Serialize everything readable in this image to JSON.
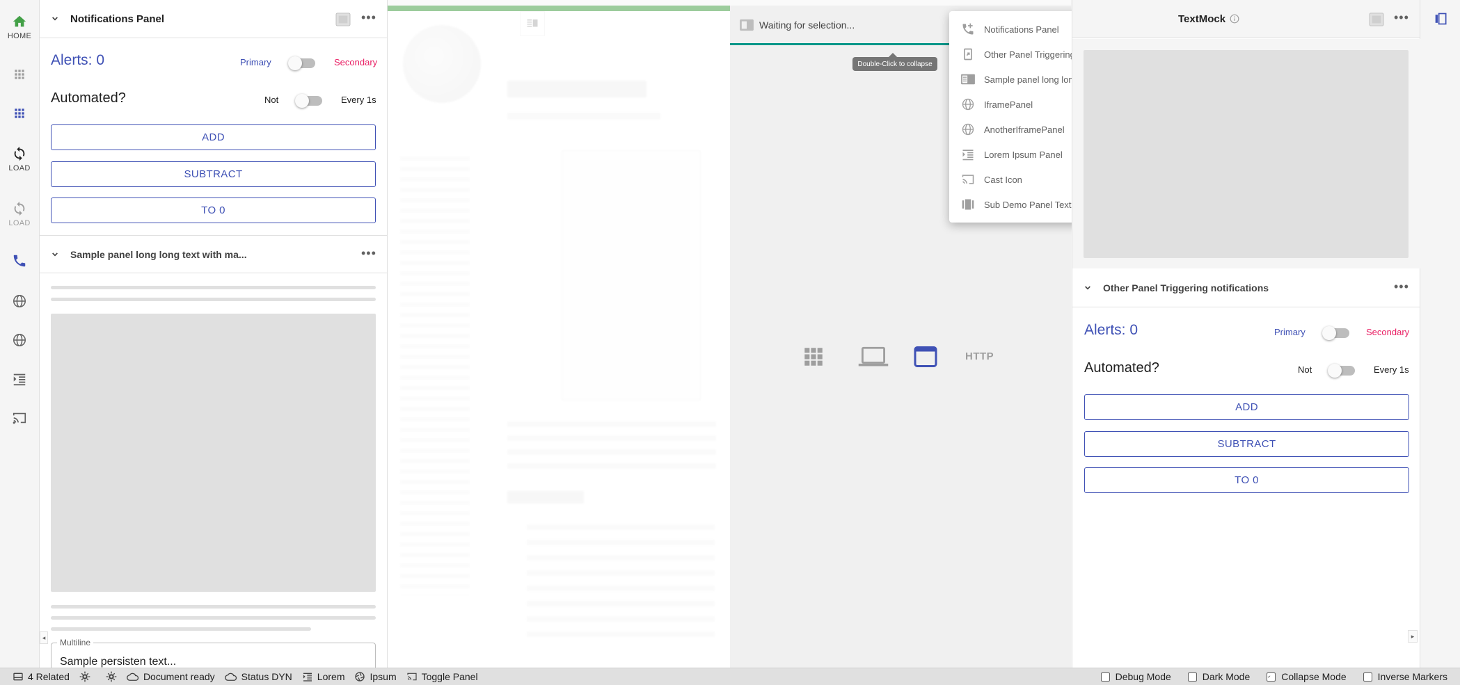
{
  "nav": {
    "home_label": "HOME",
    "load_label": "LOAD",
    "load2_label": "LOAD"
  },
  "left_panel": {
    "title": "Notifications Panel",
    "alerts": "Alerts: 0",
    "primary": "Primary",
    "secondary": "Secondary",
    "automated": "Automated?",
    "not_label": "Not",
    "every_label": "Every 1s",
    "add": "ADD",
    "subtract": "SUBTRACT",
    "to0": "TO 0"
  },
  "sample_panel": {
    "title": "Sample panel long long text with ma...",
    "multiline_label": "Multiline",
    "multiline_value": "Sample persisten text..."
  },
  "center": {
    "waiting": "Waiting for selection...",
    "tooltip": "Double-Click to collapse",
    "http_label": "HTTP"
  },
  "dropdown": {
    "items": [
      {
        "label": "Notifications Panel",
        "icon": "add-call-icon"
      },
      {
        "label": "Other Panel Triggering notifications",
        "icon": "move-up-icon"
      },
      {
        "label": "Sample panel long long text with many details",
        "icon": "vertical-split-icon"
      },
      {
        "label": "IframePanel",
        "icon": "globe-icon"
      },
      {
        "label": "AnotherIframePanel",
        "icon": "globe-icon"
      },
      {
        "label": "Lorem Ipsum Panel",
        "icon": "format-indent-icon"
      },
      {
        "label": "Cast Icon",
        "icon": "cast-icon"
      },
      {
        "label": "Sub Demo Panel TextMock",
        "icon": "view-array-icon"
      }
    ]
  },
  "right_panel": {
    "title_partial": "TextMock",
    "other_title": "Other Panel Triggering notifications",
    "alerts": "Alerts: 0",
    "primary": "Primary",
    "secondary": "Secondary",
    "automated": "Automated?",
    "not_label": "Not",
    "every_label": "Every 1s",
    "add": "ADD",
    "subtract": "SUBTRACT",
    "to0": "TO 0"
  },
  "statusbar": {
    "related": "4 Related",
    "document": "Document ready",
    "status": "Status DYN",
    "lorem": "Lorem",
    "ipsum": "Ipsum",
    "toggle": "Toggle Panel",
    "debug": "Debug Mode",
    "dark": "Dark Mode",
    "collapse": "Collapse Mode",
    "inverse": "Inverse Markers"
  },
  "colors": {
    "accent": "#3f51b5",
    "secondary": "#e91e63",
    "home": "#43a047",
    "teal": "#009688"
  }
}
